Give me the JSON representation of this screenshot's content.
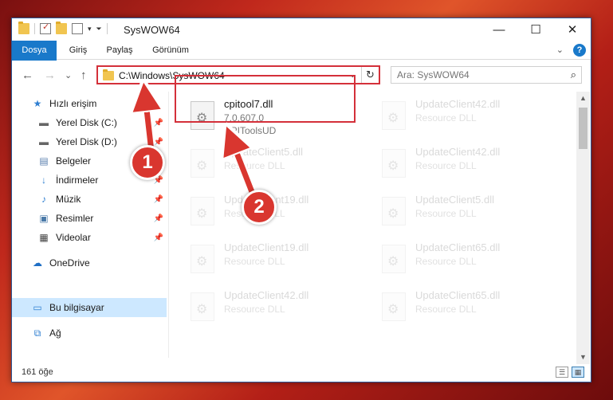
{
  "window": {
    "title": "SysWOW64",
    "controls": {
      "minimize": "—",
      "maximize": "☐",
      "close": "✕"
    }
  },
  "ribbon": {
    "tabs": [
      "Dosya",
      "Giriş",
      "Paylaş",
      "Görünüm"
    ],
    "expand_icon": "chevron-down",
    "help_label": "?"
  },
  "navigation": {
    "back": "←",
    "forward": "→",
    "recent": "⌄",
    "up": "↑"
  },
  "address": {
    "path": "C:\\Windows\\SysWOW64",
    "dropdown": "⌄",
    "refresh": "↻"
  },
  "search": {
    "placeholder": "Ara: SysWOW64",
    "icon": "search-icon"
  },
  "sidebar": {
    "items": [
      {
        "label": "Hızlı erişim",
        "icon": "star-icon",
        "pinned": false
      },
      {
        "label": "Yerel Disk (C:)",
        "icon": "drive-icon",
        "pinned": true
      },
      {
        "label": "Yerel Disk (D:)",
        "icon": "drive-icon",
        "pinned": true
      },
      {
        "label": "Belgeler",
        "icon": "document-icon",
        "pinned": true
      },
      {
        "label": "İndirmeler",
        "icon": "download-icon",
        "pinned": true
      },
      {
        "label": "Müzik",
        "icon": "music-icon",
        "pinned": true
      },
      {
        "label": "Resimler",
        "icon": "pictures-icon",
        "pinned": true
      },
      {
        "label": "Videolar",
        "icon": "video-icon",
        "pinned": true
      },
      {
        "label": "OneDrive",
        "icon": "cloud-icon",
        "pinned": false
      },
      {
        "label": "Bu bilgisayar",
        "icon": "computer-icon",
        "pinned": false,
        "selected": true
      },
      {
        "label": "Ağ",
        "icon": "network-icon",
        "pinned": false
      }
    ]
  },
  "files": {
    "highlighted": {
      "name": "cpitool7.dll",
      "version": "7.0.607.0",
      "description": "CPIToolsUD"
    },
    "others": [
      {
        "name": "UpdateClient42.dll",
        "description": "Resource DLL"
      },
      {
        "name": "UpdateClient5.dll",
        "description": "Resource DLL"
      },
      {
        "name": "UpdateClient42.dll",
        "description": "Resource DLL"
      },
      {
        "name": "UpdateClient19.dll",
        "description": "Resource DLL"
      },
      {
        "name": "UpdateClient5.dll",
        "description": "Resource DLL"
      },
      {
        "name": "UpdateClient19.dll",
        "description": "Resource DLL"
      },
      {
        "name": "UpdateClient65.dll",
        "description": "Resource DLL"
      },
      {
        "name": "UpdateClient42.dll",
        "description": "Resource DLL"
      },
      {
        "name": "UpdateClient65.dll",
        "description": "Resource DLL"
      }
    ]
  },
  "status": {
    "item_count": "161 öğe"
  },
  "annotations": [
    {
      "number": "1"
    },
    {
      "number": "2"
    }
  ],
  "colors": {
    "accent": "#1979ca",
    "highlight_red": "#d4303a",
    "selection": "#cde8ff"
  }
}
